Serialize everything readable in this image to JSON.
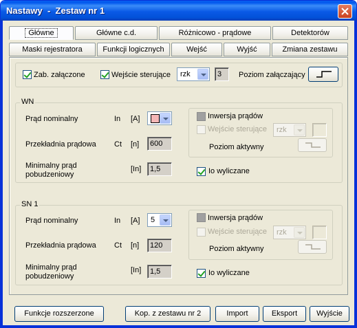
{
  "window": {
    "title": "Nastawy  -  Zestaw nr 1"
  },
  "tabs_row1": [
    "Główne",
    "Główne c.d.",
    "Różnicowo - prądowe",
    "Detektorów"
  ],
  "tabs_row2": [
    "Maski rejestratora",
    "Funkcji logicznych",
    "Wejść",
    "Wyjść",
    "Zmiana zestawu"
  ],
  "top": {
    "zab_label": "Zab. załączone",
    "wejscie_label": "Wejście sterujące",
    "wejscie_select": "rzk",
    "wejscie_number": "3",
    "poziom_label": "Poziom załączający"
  },
  "wn": {
    "title": "WN",
    "prad_label": "Prąd nominalny",
    "prad_sym": "In",
    "prad_unit": "[A]",
    "przek_label": "Przekładnia prądowa",
    "przek_sym": "Ct",
    "przek_unit": "[n]",
    "przek_value": "600",
    "min_label_1": "Minimalny prąd",
    "min_label_2": "pobudzeniowy",
    "min_unit": "[In]",
    "min_value": "1,5",
    "inwersja_label": "Inwersja prądów",
    "wej_label": "Wejście sterujące",
    "wej_select": "rzk",
    "poziom_label": "Poziom aktywny",
    "io_label": "Io wyliczane"
  },
  "sn1": {
    "title": "SN 1",
    "prad_label": "Prąd nominalny",
    "prad_sym": "In",
    "prad_unit": "[A]",
    "prad_select": "5",
    "przek_label": "Przekładnia prądowa",
    "przek_sym": "Ct",
    "przek_unit": "[n]",
    "przek_value": "120",
    "min_label_1": "Minimalny prąd",
    "min_label_2": "pobudzeniowy",
    "min_unit": "[In]",
    "min_value": "1,5",
    "inwersja_label": "Inwersja prądów",
    "wej_label": "Wejście sterujące",
    "wej_select": "rzk",
    "poziom_label": "Poziom aktywny",
    "io_label": "Io wyliczane"
  },
  "bottom": {
    "funkcje": "Funkcje rozszerzone",
    "kop": "Kop. z zestawu nr 2",
    "import": "Import",
    "eksport": "Eksport",
    "wyjscie": "Wyjście"
  },
  "colors": {
    "title_bar": "#0054e3",
    "swatch_pink": "#f4b6b6"
  }
}
